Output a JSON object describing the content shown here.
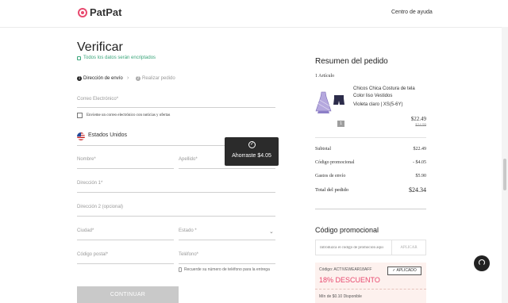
{
  "header": {
    "brand": "PatPat",
    "help_link": "Centro de ayuda"
  },
  "checkout": {
    "title": "Verificar",
    "secure_note": "Todos los datos serán encriptados",
    "steps": [
      {
        "number": "1",
        "label": "Dirección de envío"
      },
      {
        "number": "2",
        "label": "Realizar pedido"
      }
    ],
    "fields": {
      "email": "Correo Electrónico*",
      "newsletter": "Envíeme un correo electrónico con noticias y ofertas",
      "country": "Estados Unidos",
      "first_name": "Nombre*",
      "last_name": "Apellido*",
      "address1": "Dirección 1*",
      "address2": "Dirección 2 (opcional)",
      "city": "Ciudad*",
      "state": "Estado *",
      "zip": "Código postal*",
      "phone": "Teléfono*",
      "phone_note": "Recuerde su número de teléfono para la entrega"
    },
    "continue_button": "CONTINUAR"
  },
  "toast": {
    "message": "Ahorraste $4.05"
  },
  "summary": {
    "title": "Resumen del pedido",
    "article_count": "1 Artículo",
    "product": {
      "name": "Chicos Chica Costura de tela Color liso Vestidos",
      "variant": "Violeta claro | XS(5-6Y)",
      "quantity": "1",
      "price": "$22.49",
      "old_price": "$24.99"
    },
    "rows": [
      {
        "label": "Subtotal",
        "value": "$22.49"
      },
      {
        "label": "Código promocional",
        "value": "- $4.05"
      },
      {
        "label": "Gastos de envío",
        "value": "$5.90"
      }
    ],
    "total": {
      "label": "Total del pedido",
      "value": "$24.34"
    }
  },
  "promo": {
    "title": "Código promocional",
    "placeholder": "Introduzca el código de promoción aquí",
    "apply_button": "APLICAR",
    "coupon": {
      "code": "Código: ACTIVEWEAR18AFF",
      "status": "✓ APLICADO",
      "discount": "18% DESCUENTO",
      "minimum": "Mín de $0.10 Disponible"
    }
  },
  "colors": {
    "brand": "#e84a6f",
    "secure": "#3aa57a",
    "toast_bg": "#2b2b2b",
    "button_disabled": "#c9c9c9",
    "coupon_bg": "#fdf1ee"
  },
  "icons": [
    "logo-icon",
    "lock-icon",
    "chevron-right-icon",
    "us-flag-icon",
    "check-circle-icon",
    "chevron-down-icon",
    "phone-icon",
    "headset-icon"
  ]
}
